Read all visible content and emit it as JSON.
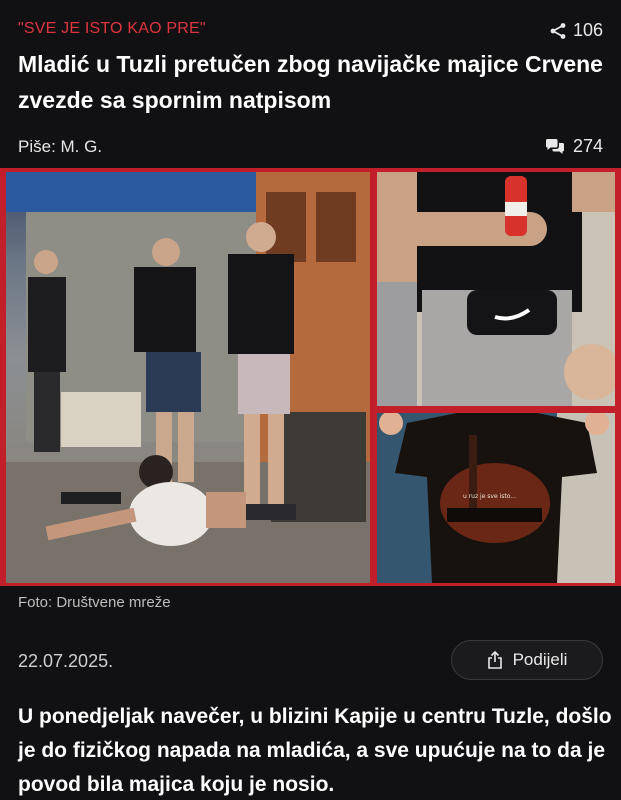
{
  "article": {
    "kicker": "\"SVE JE ISTO KAO PRE\"",
    "share_count": "106",
    "headline": "Mladić u Tuzli pretučen zbog navijačke majice Crvene zvezde sa spornim natpisom",
    "author": "Piše: M. G.",
    "comment_count": "274",
    "photo_caption": "Foto: Društvene mreže",
    "date": "22.07.2025.",
    "share_button_label": "Podijeli",
    "lead": "U ponedjeljak navečer, u blizini Kapije u centru Tuzle, došlo je do fizičkog napada na mladića, a sve upućuje na to da je povod bila majica koju je nosio."
  },
  "photo": {
    "shirt_text": "u ruz je sve isto..."
  },
  "icons": {
    "share": "share-icon",
    "comments": "comments-icon",
    "share_button": "upload-icon"
  },
  "colors": {
    "background": "#111113",
    "accent": "#e0353f",
    "photo_border": "#c21f2a"
  }
}
